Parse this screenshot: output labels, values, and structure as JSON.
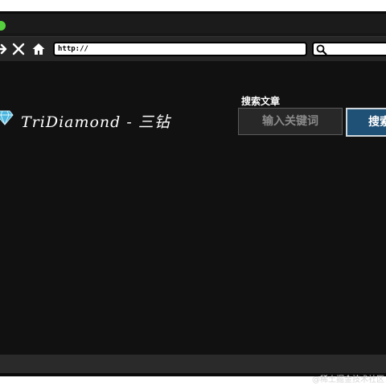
{
  "browser": {
    "url_text": "http://",
    "search_placeholder": ""
  },
  "page": {
    "site_title": "TriDiamond - 三钻",
    "search": {
      "label": "搜索文章",
      "input_placeholder": "输入关键词",
      "button_label": "搜索"
    }
  },
  "watermark": "@稀土掘金技术社区",
  "colors": {
    "background": "#171717",
    "content": "#111111",
    "accent_button": "#1f5075",
    "traffic_light": "#55d13e",
    "logo": "#5bc3e8"
  },
  "icons": [
    "forward-arrow-icon",
    "close-icon",
    "home-icon",
    "magnifier-icon",
    "diamond-logo-icon"
  ]
}
